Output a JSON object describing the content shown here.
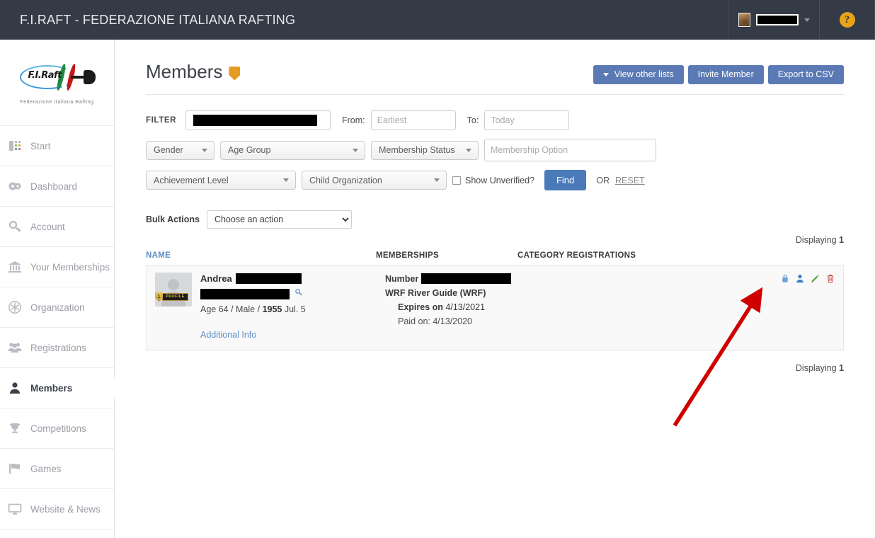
{
  "topbar": {
    "title": "F.I.RAFT - FEDERAZIONE ITALIANA RAFTING",
    "user_name_redacted": true,
    "avatar_icon": "user-thumbnail",
    "dropdown_icon": "chevron-down-icon",
    "help_icon": "help-question-icon",
    "help_label": "?"
  },
  "sidebar": {
    "logo": {
      "wordmark": "F.I.Raft",
      "subtitle": "Federazione Italiana Rafting"
    },
    "items": [
      {
        "label": "Start",
        "icon": "grid-icon",
        "active": false
      },
      {
        "label": "Dashboard",
        "icon": "gauge-icon",
        "active": false
      },
      {
        "label": "Account",
        "icon": "key-icon",
        "active": false
      },
      {
        "label": "Your Memberships",
        "icon": "bank-icon",
        "active": false
      },
      {
        "label": "Organization",
        "icon": "asterisk-icon",
        "active": false
      },
      {
        "label": "Registrations",
        "icon": "people-icon",
        "active": false
      },
      {
        "label": "Members",
        "icon": "person-icon",
        "active": true
      },
      {
        "label": "Competitions",
        "icon": "trophy-icon",
        "active": false
      },
      {
        "label": "Games",
        "icon": "flag-icon",
        "active": false
      },
      {
        "label": "Website & News",
        "icon": "monitor-icon",
        "active": false
      }
    ]
  },
  "page": {
    "title": "Members",
    "title_badge_icon": "shield-icon",
    "actions": [
      {
        "label": "View other lists",
        "icon": "caret-down-icon"
      },
      {
        "label": "Invite Member",
        "icon": ""
      },
      {
        "label": "Export to CSV",
        "icon": ""
      }
    ]
  },
  "filters": {
    "label": "FILTER",
    "search_value_redacted": true,
    "from_label": "From:",
    "from_placeholder": "Earliest",
    "to_label": "To:",
    "to_placeholder": "Today",
    "gender": "Gender",
    "age_group": "Age Group",
    "membership_status": "Membership Status",
    "membership_option_placeholder": "Membership Option",
    "achievement_level": "Achievement Level",
    "child_organization": "Child Organization",
    "show_unverified": "Show Unverified?",
    "show_unverified_checked": false,
    "find_label": "Find",
    "or_label": "OR",
    "reset_label": "RESET"
  },
  "bulk": {
    "label": "Bulk Actions",
    "selected": "Choose an action"
  },
  "table": {
    "displaying_top_prefix": "Displaying",
    "displaying_top_count": "1",
    "displaying_bottom_prefix": "Displaying",
    "displaying_bottom_count": "1",
    "headers": {
      "name": "NAME",
      "memberships": "MEMBERSHIPS",
      "category_registrations": "CATEGORY REGISTRATIONS"
    },
    "rows": [
      {
        "avatar_icon": "avatar-placeholder-icon",
        "profile_badge_label": "PROFILE",
        "first_name": "Andrea",
        "last_name_redacted": true,
        "secondary_line_redacted": true,
        "search_icon": "key-search-icon",
        "meta_prefix": "Age 64 / Male /",
        "meta_year": "1955",
        "meta_suffix": "Jul. 5",
        "additional_info": "Additional Info",
        "membership_number_label": "Number",
        "membership_number_redacted": true,
        "membership_name": "WRF River Guide (WRF)",
        "expires_label": "Expires on",
        "expires_date": "4/13/2021",
        "paid_label": "Paid on:",
        "paid_date": "4/13/2020",
        "category_registrations": "",
        "actions": [
          {
            "icon": "lock-icon",
            "color": "#6ba3d6"
          },
          {
            "icon": "person-icon",
            "color": "#3b7ec4"
          },
          {
            "icon": "pencil-icon",
            "color": "#5ea63c"
          },
          {
            "icon": "trash-icon",
            "color": "#cc4b4b"
          }
        ]
      }
    ]
  },
  "annotation": {
    "arrow_color": "#d00000",
    "points_to": "pencil-icon"
  },
  "colors": {
    "topbar_bg": "#343a46",
    "button_blue": "#5b7ab5",
    "link_blue": "#5b8cc4",
    "accent_orange": "#e59b20"
  }
}
